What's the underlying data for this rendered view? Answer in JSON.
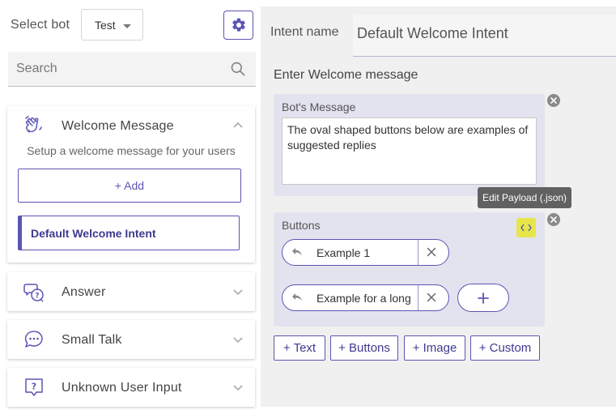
{
  "header": {
    "select_bot_label": "Select bot",
    "bot_value": "Test"
  },
  "search": {
    "placeholder": "Search"
  },
  "sidebar": {
    "sections": [
      {
        "title": "Welcome Message",
        "icon": "waving-hand-icon",
        "expanded": true,
        "description": "Setup a welcome message for your users",
        "add_label": "+ Add",
        "items": [
          {
            "label": "Default Welcome Intent",
            "selected": true
          }
        ]
      },
      {
        "title": "Answer",
        "icon": "chat-question-icon",
        "expanded": false
      },
      {
        "title": "Small Talk",
        "icon": "chat-dots-icon",
        "expanded": false
      },
      {
        "title": "Unknown User Input",
        "icon": "question-box-icon",
        "expanded": false
      }
    ]
  },
  "main": {
    "intent_label": "Intent name",
    "intent_value": "Default Welcome Intent",
    "section_title": "Enter Welcome message",
    "message_block": {
      "label": "Bot's Message",
      "text": "The oval shaped buttons below are examples of suggested replies"
    },
    "tooltip": "Edit Payload (.json)",
    "buttons_block": {
      "label": "Buttons",
      "buttons": [
        {
          "text": "Example 1"
        },
        {
          "text": "Example for a long"
        }
      ]
    },
    "add_actions": [
      "+ Text",
      "+ Buttons",
      "+ Image",
      "+ Custom"
    ]
  },
  "colors": {
    "accent": "#5b55b4",
    "block_bg": "#e3e3ef",
    "highlight": "#e6e64a"
  }
}
